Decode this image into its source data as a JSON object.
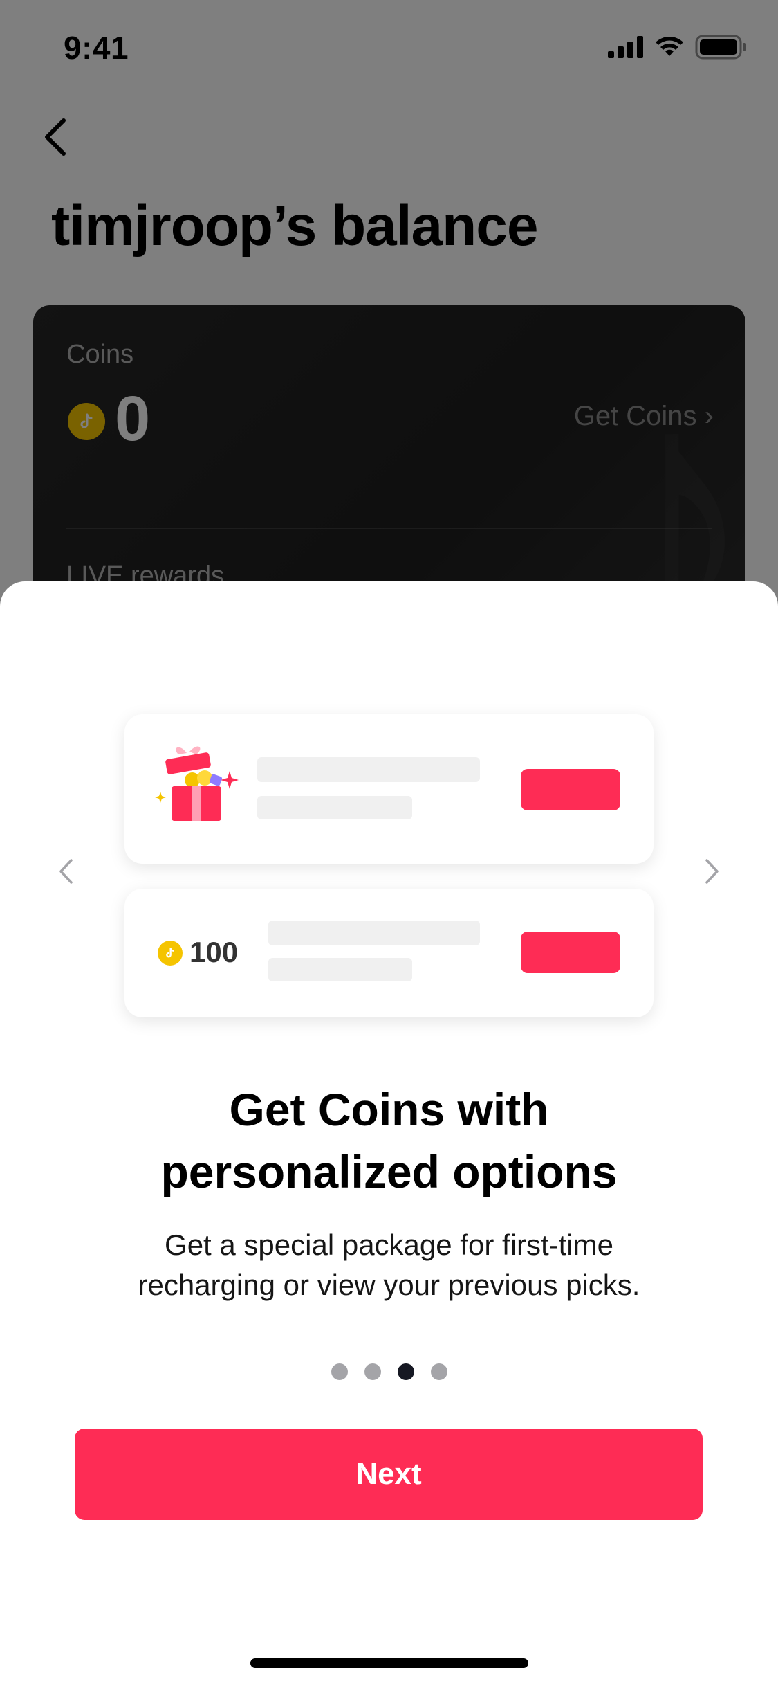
{
  "status_bar": {
    "time": "9:41",
    "icons": [
      "cellular-signal-icon",
      "wifi-icon",
      "battery-icon"
    ]
  },
  "header": {
    "back_icon": "chevron-left-icon",
    "title": "timjroop’s balance"
  },
  "balance_card": {
    "coins_label": "Coins",
    "coins_value": "0",
    "get_coins_label": "Get Coins ›",
    "live_rewards_label": "LIVE rewards"
  },
  "sheet": {
    "illustration": {
      "coin_amount": "100"
    },
    "title_line1": "Get Coins with",
    "title_line2": "personalized options",
    "description_line1": "Get a special package for first-time",
    "description_line2": "recharging or view your previous picks.",
    "pagination": {
      "total": 4,
      "active_index": 2
    },
    "next_label": "Next"
  },
  "colors": {
    "accent": "#fe2c55",
    "coin": "#f5c400",
    "dot_inactive": "#a4a4a8",
    "dot_active": "#161823"
  }
}
